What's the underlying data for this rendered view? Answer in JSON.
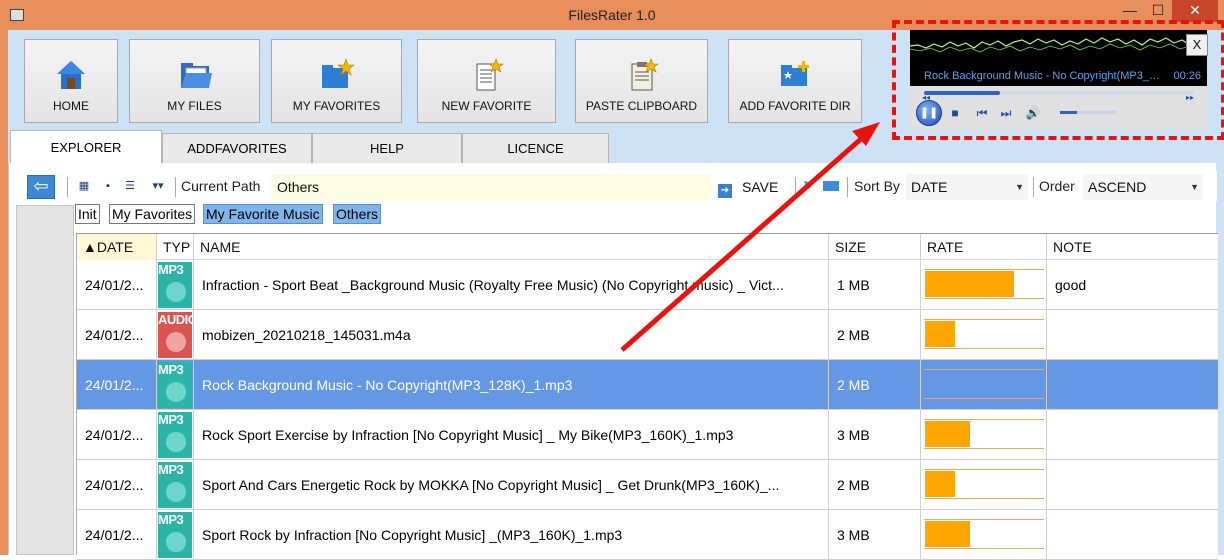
{
  "window": {
    "title": "FilesRater 1.0",
    "minimize_glyph": "—",
    "maximize_glyph": "☐",
    "close_glyph": "✕"
  },
  "toolbar": [
    {
      "id": "home",
      "label": "HOME",
      "icon": "home-icon"
    },
    {
      "id": "my-files",
      "label": "MY FILES",
      "icon": "folder-open-icon"
    },
    {
      "id": "my-favorites",
      "label": "MY FAVORITES",
      "icon": "folder-star-icon"
    },
    {
      "id": "new-favorite",
      "label": "NEW FAVORITE",
      "icon": "document-star-icon"
    },
    {
      "id": "paste-clipboard",
      "label": "PASTE CLIPBOARD",
      "icon": "clipboard-star-icon"
    },
    {
      "id": "add-favorite-dir",
      "label": "ADD FAVORITE DIR",
      "icon": "folder-add-icon"
    }
  ],
  "tabs": [
    {
      "label": "EXPLORER",
      "active": true
    },
    {
      "label": "ADDFAVORITES",
      "active": false
    },
    {
      "label": "HELP",
      "active": false
    },
    {
      "label": "LICENCE",
      "active": false
    }
  ],
  "pathbar": {
    "back_glyph": "⇦",
    "current_path_label": "Current Path",
    "current_path_value": "Others",
    "save_label": "SAVE",
    "sort_by_label": "Sort By",
    "sort_by_value": "DATE",
    "order_label": "Order",
    "order_value": "ASCEND"
  },
  "filters": [
    {
      "label": "Init",
      "selected": false
    },
    {
      "label": "My Favorites",
      "selected": false
    },
    {
      "label": "My Favorite Music",
      "selected": true
    },
    {
      "label": "Others",
      "selected": true
    }
  ],
  "table": {
    "columns": [
      "▲DATE",
      "TYP",
      "NAME",
      "SIZE",
      "RATE",
      "NOTE"
    ],
    "rows": [
      {
        "date": "24/01/2...",
        "type": "MP3",
        "name": "Infraction - Sport Beat _Background Music (Royalty Free Music) (No Copyright music) _ Vict...",
        "size": "1 MB",
        "rate": 0.75,
        "note": "good",
        "selected": false
      },
      {
        "date": "24/01/2...",
        "type": "AUDIO",
        "name": "mobizen_20210218_145031.m4a",
        "size": "2 MB",
        "rate": 0.25,
        "note": "",
        "selected": false
      },
      {
        "date": "24/01/2...",
        "type": "MP3",
        "name": "Rock Background Music - No Copyright(MP3_128K)_1.mp3",
        "size": "2 MB",
        "rate": 0.0,
        "note": "",
        "selected": true
      },
      {
        "date": "24/01/2...",
        "type": "MP3",
        "name": "Rock Sport Exercise by Infraction [No Copyright Music] _ My Bike(MP3_160K)_1.mp3",
        "size": "3 MB",
        "rate": 0.38,
        "note": "",
        "selected": false
      },
      {
        "date": "24/01/2...",
        "type": "MP3",
        "name": "Sport And Cars Energetic Rock by MOKKA [No Copyright Music] _ Get Drunk(MP3_160K)_...",
        "size": "2 MB",
        "rate": 0.25,
        "note": "",
        "selected": false
      },
      {
        "date": "24/01/2...",
        "type": "MP3",
        "name": "Sport Rock by Infraction [No Copyright Music] _(MP3_160K)_1.mp3",
        "size": "3 MB",
        "rate": 0.38,
        "note": "",
        "selected": false
      }
    ]
  },
  "player": {
    "track_title": "Rock Background Music - No Copyright(MP3_128...",
    "time": "00:26",
    "close_label": "X",
    "progress": 0.28,
    "volume": 0.3
  },
  "colors": {
    "titlebar": "#e88e5a",
    "selection": "#6598e4",
    "rating": "#ffa500",
    "annotation": "#e8130e"
  }
}
